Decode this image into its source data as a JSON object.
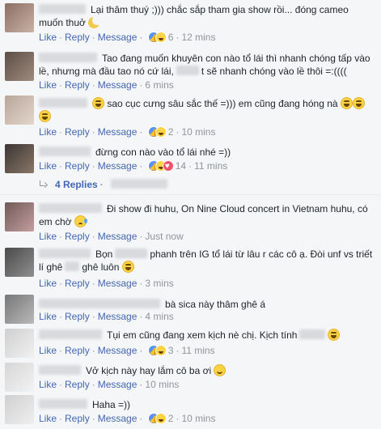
{
  "actions": {
    "like": "Like",
    "reply": "Reply",
    "message": "Message",
    "sep": "·"
  },
  "replies_toggle": {
    "label": "4 Replies",
    "sep": "·"
  },
  "comments": [
    {
      "id": "c1",
      "text": "Lại thâm thuý ;))) chắc sắp tham gia show rồi... đóng cameo muốn thuở",
      "reactions": [
        "like",
        "haha"
      ],
      "count": "6",
      "time": "12 mins",
      "avatar_colors": [
        "#8c6e63",
        "#c9b3a5"
      ]
    },
    {
      "id": "c2",
      "text_a": "Tao đang muốn khuyên con nào tổ lái thì nhanh chóng tấp vào lề, nhưng mà đầu tao nó cứ lái,",
      "text_b": "t sẽ nhanh chóng vào lề thôi =:((((",
      "count": "",
      "time": "6 mins",
      "avatar_colors": [
        "#5b4d46",
        "#9f8c7f"
      ]
    },
    {
      "id": "c3",
      "text": "sao cục cưng sâu sắc thế =))) em cũng đang hóng nà",
      "reactions": [
        "like",
        "haha"
      ],
      "count": "2",
      "time": "10 mins",
      "avatar_colors": [
        "#b7a69a",
        "#e4d6cc"
      ]
    },
    {
      "id": "c4",
      "text": "đừng con nào vào tổ lái nhé =))",
      "reactions": [
        "like",
        "haha",
        "heart"
      ],
      "count": "14",
      "time": "11 mins",
      "avatar_colors": [
        "#3b3532",
        "#8a7769"
      ]
    },
    {
      "id": "c5",
      "text": "Đi show đi huhu, On Nine Cloud concert in Vietnam huhu, có em chờ",
      "count": "",
      "time": "Just now",
      "avatar_colors": [
        "#6f5a57",
        "#c59ea0"
      ]
    },
    {
      "id": "c6",
      "text_a": "Bọn",
      "text_b": "phanh trên IG tổ lái từ lâu r các cô ạ. Đòi unf vs triết lí ghê",
      "text_c": "ghê luôn",
      "count": "",
      "time": "3 mins",
      "avatar_colors": [
        "#4a4a4a",
        "#8f8f8f"
      ]
    },
    {
      "id": "c7",
      "text": "bà sica này thâm ghê á",
      "count": "",
      "time": "4 mins",
      "avatar_colors": [
        "#777777",
        "#b9b9b9"
      ]
    },
    {
      "id": "c8",
      "text": "Tụi em cũng đang xem kịch nè chị. Kịch tính",
      "reactions": [
        "like",
        "haha"
      ],
      "count": "3",
      "time": "11 mins",
      "avatar_colors": [
        "#cfcfcf",
        "#f1f1f1"
      ]
    },
    {
      "id": "c9",
      "text": "Vở kịch này hay lắm cô ba ơi",
      "count": "",
      "time": "10 mins",
      "avatar_colors": [
        "#d6d6d6",
        "#f3f3f3"
      ]
    },
    {
      "id": "c10",
      "text": "Haha =))",
      "reactions": [
        "like",
        "haha"
      ],
      "count": "2",
      "time": "10 mins",
      "avatar_colors": [
        "#d0d0d0",
        "#efefef"
      ]
    }
  ],
  "icons": {
    "like_reaction": "like-reaction-icon",
    "haha_reaction": "haha-reaction-icon",
    "love_reaction": "love-reaction-icon",
    "laugh_emoji": "laughing-emoji-icon",
    "smile_emoji": "smiling-emoji-icon",
    "sad_emoji": "crying-emoji-icon",
    "moon_emoji": "crescent-moon-emoji-icon"
  },
  "colors": {
    "link": "#4267b2",
    "meta": "#90949c",
    "text": "#1d2129",
    "background": "#f5f6f7"
  }
}
